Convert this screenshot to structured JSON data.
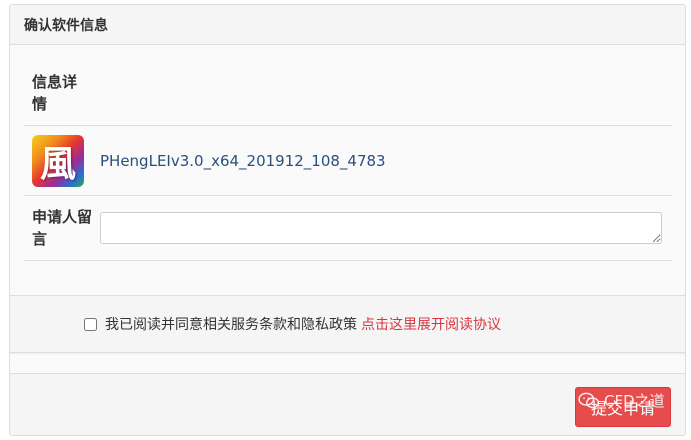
{
  "panel": {
    "title": "确认软件信息"
  },
  "details": {
    "label": "信息详情"
  },
  "file": {
    "icon": "app-logo-icon",
    "icon_glyph": "風",
    "name": "PHengLEIv3.0_x64_201912_108_4783"
  },
  "note": {
    "label": "申请人留言",
    "value": "",
    "placeholder": ""
  },
  "agreement": {
    "checked": false,
    "text": "我已阅读并同意相关服务条款和隐私政策",
    "link_text": "点击这里展开阅读协议",
    "link_color": "#d9363e"
  },
  "footer": {
    "submit_label": "提交申请",
    "submit_color": "#e74c4c"
  },
  "watermark": {
    "text": "CFD之道",
    "icon": "wechat-icon"
  }
}
